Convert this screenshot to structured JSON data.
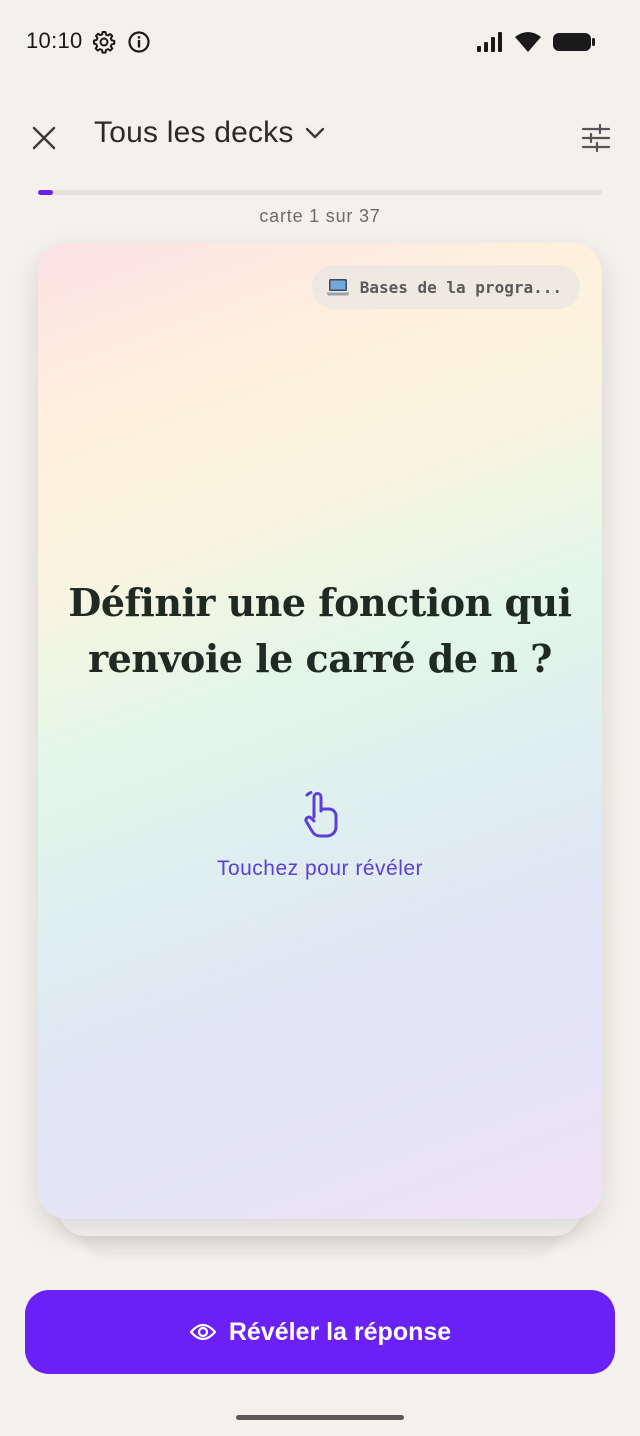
{
  "status_bar": {
    "time": "10:10"
  },
  "header": {
    "deck_title": "Tous les decks"
  },
  "progress": {
    "label": "carte 1 sur 37",
    "current": 1,
    "total": 37,
    "fraction": 0.027
  },
  "card": {
    "deck_chip": "Bases de la progra...",
    "question": "Définir une fonction qui renvoie le carré de n ?",
    "tap_hint": "Touchez pour révéler"
  },
  "actions": {
    "reveal_label": "Révéler la réponse"
  },
  "colors": {
    "accent": "#6b21f5",
    "background": "#f4f1ec",
    "hint": "#5b3fd9",
    "question_text": "#1f2a22"
  },
  "icons": {
    "close": "close-icon",
    "chevron": "chevron-down-icon",
    "settings": "sliders-icon",
    "chip": "laptop-icon",
    "tap": "tap-finger-icon",
    "reveal": "eye-icon"
  }
}
